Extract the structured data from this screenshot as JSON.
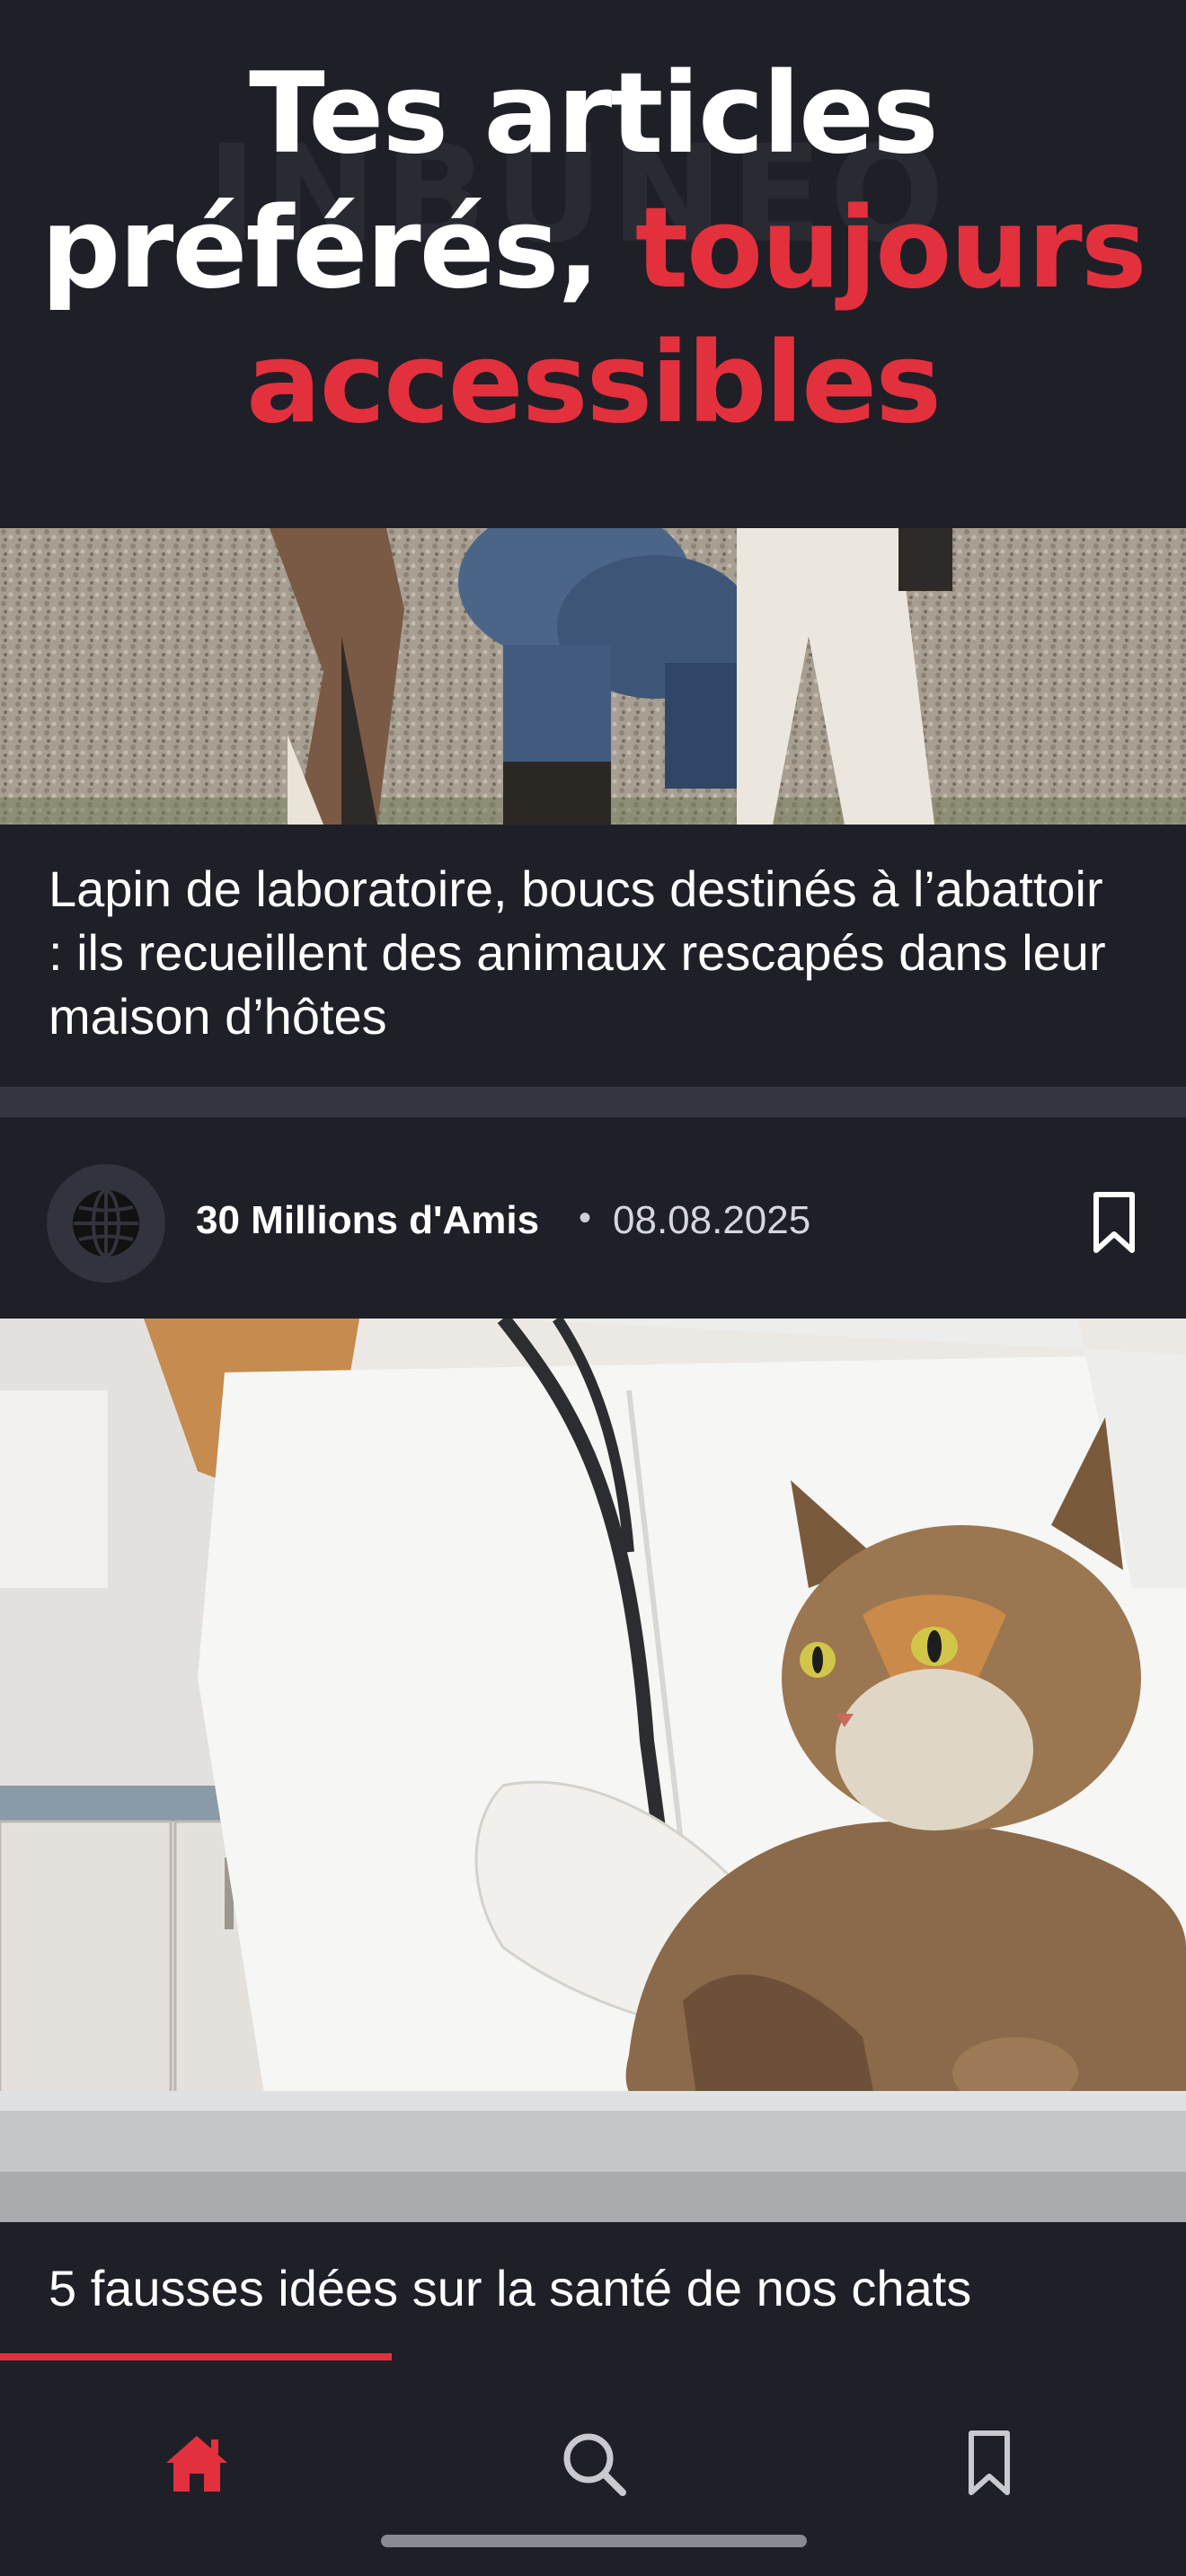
{
  "hero": {
    "line1": "Tes articles",
    "line2_white": "préférés, ",
    "line2_red": "toujours",
    "line3_red": "accessibles",
    "watermark": "INBUNEO"
  },
  "articles": [
    {
      "title": "Lapin de laboratoire, boucs destinés à l’abattoir : ils recueillent des animaux rescapés dans leur maison d’hôtes",
      "image": "goats-kneeling-person-photo"
    },
    {
      "source": "30 Millions d'Amis",
      "separator": "•",
      "date": "08.08.2025",
      "title": "5 fausses idées sur la santé de nos chats",
      "image": "veterinarian-cat-stethoscope-photo"
    }
  ],
  "reading_progress": 0.33,
  "tabbar": {
    "items": [
      {
        "name": "home",
        "icon": "home-icon",
        "active": true
      },
      {
        "name": "search",
        "icon": "search-icon",
        "active": false
      },
      {
        "name": "bookmarks",
        "icon": "bookmark-icon",
        "active": false
      }
    ]
  },
  "colors": {
    "background": "#1f1f28",
    "accent": "#e2313d",
    "separator": "#353540",
    "inactive_icon": "#c9c9cf"
  }
}
